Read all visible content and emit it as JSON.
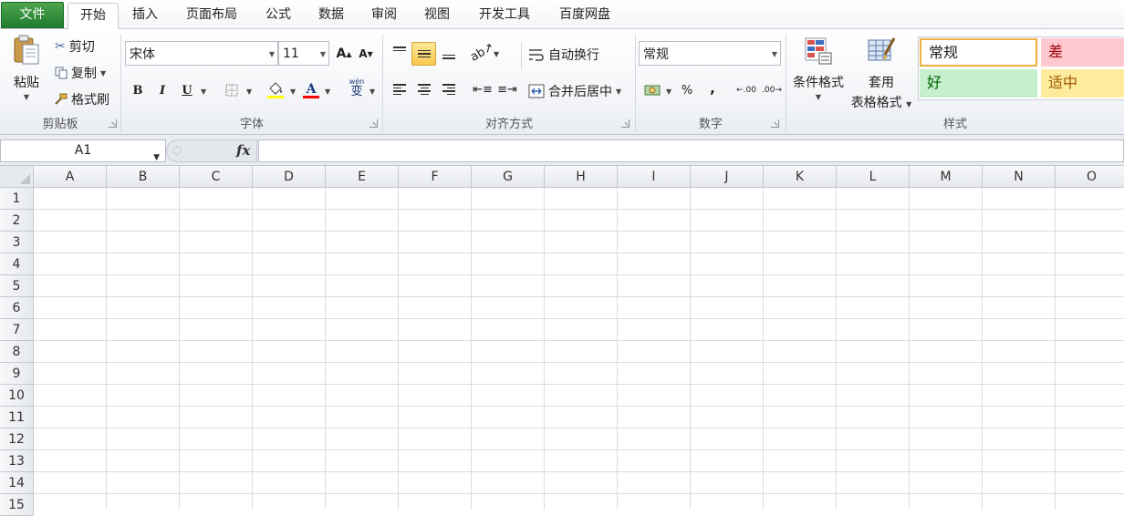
{
  "menu": {
    "tabs": [
      {
        "label": "文件"
      },
      {
        "label": "开始"
      },
      {
        "label": "插入"
      },
      {
        "label": "页面布局"
      },
      {
        "label": "公式"
      },
      {
        "label": "数据"
      },
      {
        "label": "审阅"
      },
      {
        "label": "视图"
      },
      {
        "label": "开发工具"
      },
      {
        "label": "百度网盘"
      }
    ],
    "active_tab": "开始"
  },
  "ribbon": {
    "clipboard": {
      "paste": "粘贴",
      "cut": "剪切",
      "copy": "复制",
      "format_painter": "格式刷",
      "label": "剪贴板"
    },
    "font": {
      "font_name": "宋体",
      "font_size": "11",
      "grow": "A",
      "shrink": "A",
      "bold": "B",
      "italic": "I",
      "underline": "U",
      "phonetic": "wén",
      "phonetic_char": "变",
      "label": "字体"
    },
    "alignment": {
      "wrap_text": "自动换行",
      "merge_center": "合并后居中",
      "label": "对齐方式"
    },
    "number": {
      "format": "常规",
      "percent": "%",
      "comma": ",",
      "increase_decimal": ".00",
      "decrease_decimal": ".00",
      "label": "数字"
    },
    "styles": {
      "conditional_formatting": "条件格式",
      "format_as_table_line1": "套用",
      "format_as_table_line2": "表格格式",
      "gallery": [
        {
          "label": "常规",
          "bg": "#ffffff"
        },
        {
          "label": "差",
          "bg": "#ffc7ce"
        },
        {
          "label": "好",
          "bg": "#c6efce"
        },
        {
          "label": "适中",
          "bg": "#ffeb9c"
        }
      ],
      "label": "样式"
    }
  },
  "formula_bar": {
    "name_box": "A1",
    "fx": "fx",
    "formula": ""
  },
  "sheet": {
    "columns": [
      "A",
      "B",
      "C",
      "D",
      "E",
      "F",
      "G",
      "H",
      "I",
      "J",
      "K",
      "L",
      "M",
      "N",
      "O"
    ],
    "rows": [
      "1",
      "2",
      "3",
      "4",
      "5",
      "6",
      "7",
      "8",
      "9",
      "10",
      "11",
      "12",
      "13",
      "14",
      "15"
    ]
  },
  "colors": {
    "file_tab": "#2e8b3b",
    "selected_align": "#f8c94d",
    "fill_color": "#ffff00",
    "font_color": "#ff0000"
  }
}
